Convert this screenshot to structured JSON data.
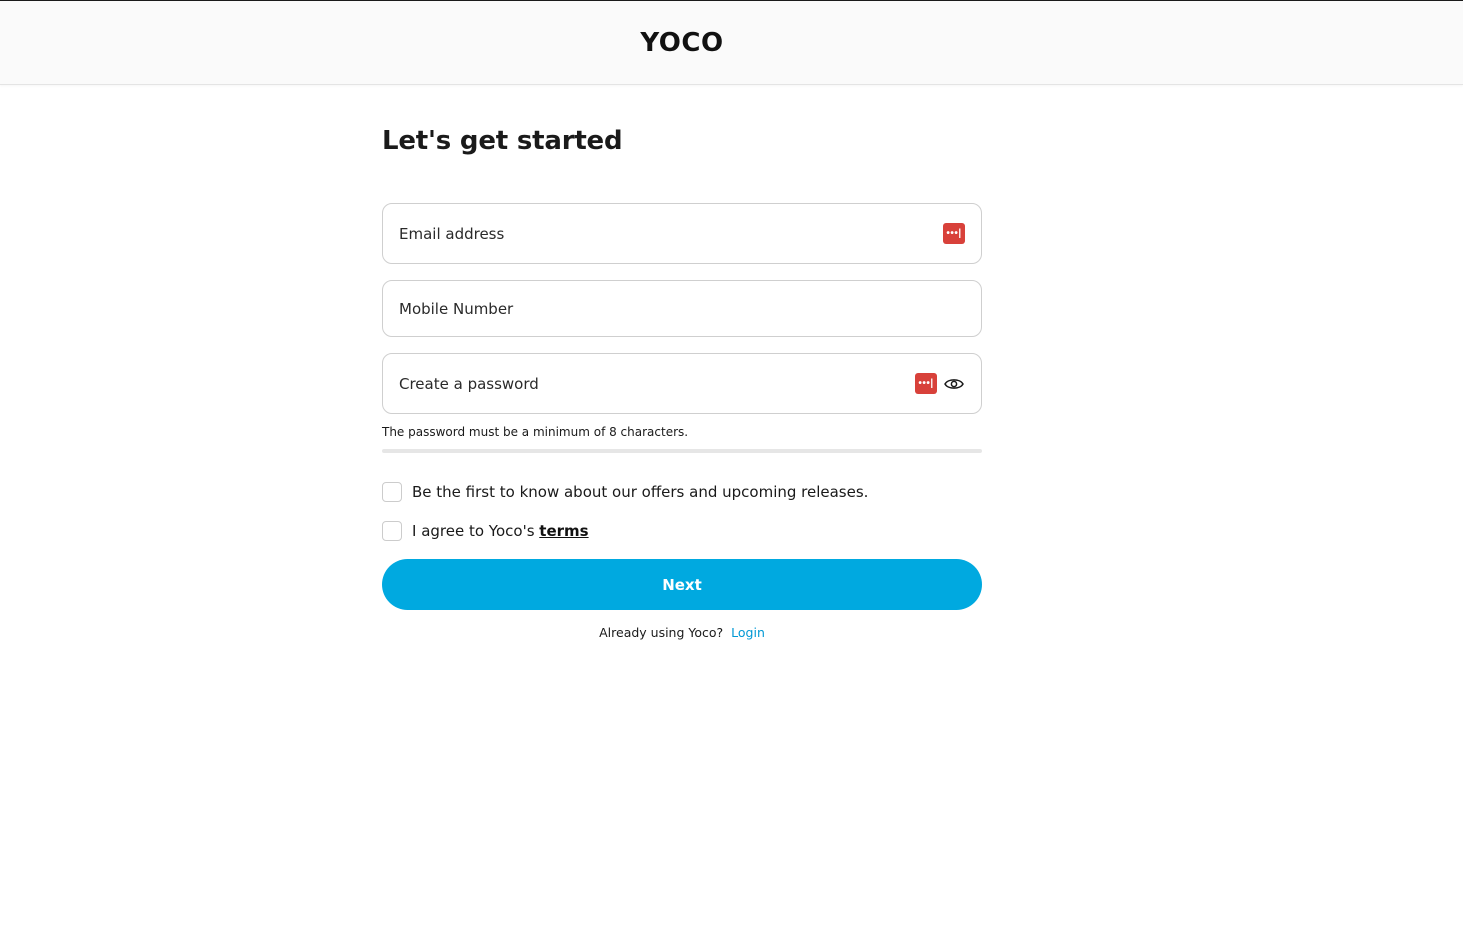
{
  "header": {
    "logo_text": "YOCO"
  },
  "form": {
    "title": "Let's get started",
    "email": {
      "placeholder": "Email address",
      "value": ""
    },
    "mobile": {
      "placeholder": "Mobile Number",
      "value": ""
    },
    "password": {
      "placeholder": "Create a password",
      "value": "",
      "hint": "The password must be a minimum of 8 characters."
    },
    "password_manager_icon_text": "•••|",
    "checkboxes": [
      {
        "label": "Be the first to know about our offers and upcoming releases.",
        "checked": false
      },
      {
        "label_prefix": "I agree to Yoco's ",
        "link": "terms",
        "checked": false
      }
    ],
    "next_label": "Next",
    "login_prompt": "Already using Yoco?",
    "login_link": "Login"
  },
  "colors": {
    "primary": "#00a9e0",
    "link": "#0098d4",
    "password_manager": "#d8413a"
  },
  "icons": [
    "password-manager-icon",
    "eye-icon"
  ]
}
